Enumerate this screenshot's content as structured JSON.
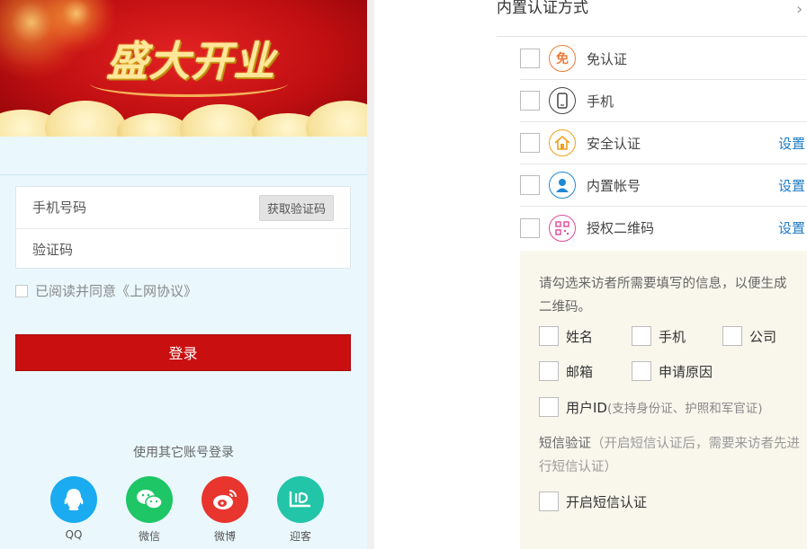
{
  "login_preview": {
    "banner_title": "盛大开业",
    "phone_placeholder": "手机号码",
    "code_placeholder": "验证码",
    "get_code_label": "获取验证码",
    "agree_text": "已阅读并同意《上网协议》",
    "login_button_label": "登录",
    "other_login_label": "使用其它账号登录",
    "social": [
      {
        "label": "QQ",
        "icon": "qq-icon",
        "color": "#1aabf0"
      },
      {
        "label": "微信",
        "icon": "wechat-icon",
        "color": "#1ec665"
      },
      {
        "label": "微博",
        "icon": "weibo-icon",
        "color": "#e8352e"
      },
      {
        "label": "迎客",
        "icon": "guest-icon",
        "color": "#22c5a7"
      }
    ]
  },
  "auth": {
    "title": "内置认证方式",
    "methods": [
      {
        "label": "免认证",
        "icon": "free-auth-icon",
        "glyph": "免",
        "color": "#f07a3a",
        "setting": ""
      },
      {
        "label": "手机",
        "icon": "mobile-phone-icon",
        "glyph": "▯",
        "color": "#444444",
        "setting": ""
      },
      {
        "label": "安全认证",
        "icon": "home-shield-icon",
        "glyph": "⌂",
        "color": "#f0a020",
        "setting": "设置"
      },
      {
        "label": "内置帐号",
        "icon": "user-account-icon",
        "glyph": "●",
        "color": "#1e88d2",
        "setting": "设置"
      },
      {
        "label": "授权二维码",
        "icon": "qr-code-icon",
        "glyph": "▦",
        "color": "#e0489a",
        "setting": "设置"
      }
    ]
  },
  "visitor_info": {
    "description": "请勾选来访者所需要填写的信息，以便生成二维码。",
    "fields": {
      "name": "姓名",
      "mobile": "手机",
      "company": "公司",
      "email": "邮箱",
      "reason": "申请原因",
      "user_id": "用户ID",
      "user_id_note": "(支持身份证、护照和军官证)"
    },
    "sms_title": "短信验证",
    "sms_note": "（开启短信认证后，需要来访者先进行短信认证）",
    "sms_enable_label": "开启短信认证"
  }
}
